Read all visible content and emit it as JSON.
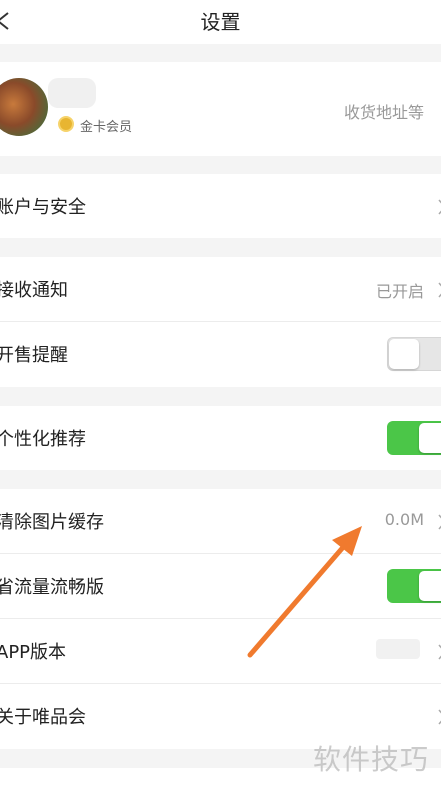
{
  "header": {
    "title": "设置"
  },
  "profile": {
    "membership_label": "金卡会员",
    "address_label": "收货地址等"
  },
  "settings": {
    "account_security": {
      "label": "账户与安全"
    },
    "notifications": {
      "label": "接收通知",
      "value": "已开启"
    },
    "sale_reminder": {
      "label": "开售提醒",
      "toggle": "off"
    },
    "personalized": {
      "label": "个性化推荐",
      "toggle": "on"
    },
    "clear_cache": {
      "label": "清除图片缓存",
      "value": "0.0M"
    },
    "data_saver": {
      "label": "省流量流畅版",
      "toggle": "on"
    },
    "app_version": {
      "label": "APP版本"
    },
    "about": {
      "label": "关于唯品会"
    }
  },
  "watermark": "软件技巧",
  "colors": {
    "toggle_on": "#4bc648",
    "arrow": "#f07a2e",
    "gold_badge": "#e8b531"
  },
  "icons": [
    "back-chevron-icon",
    "chevron-right-icon",
    "gold-member-icon",
    "annotation-arrow"
  ]
}
